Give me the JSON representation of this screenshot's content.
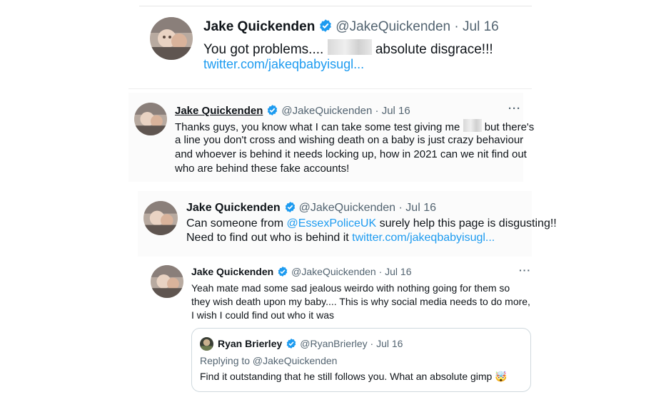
{
  "tweet1": {
    "name": "Jake Quickenden",
    "handle": "@JakeQuickenden",
    "date": "· Jul 16",
    "text_before": "You got problems....",
    "text_after": "absolute disgrace!!!",
    "link": "twitter.com/jakeqbabyisugl..."
  },
  "tweet2": {
    "name": "Jake Quickenden",
    "handle": "@JakeQuickenden",
    "date": "· Jul 16",
    "more": "···",
    "line1_a": "Thanks guys, you know what I can take some test giving me",
    "line1_b": "but there's",
    "line2": "a line you don't cross and wishing death on a baby is just crazy behaviour",
    "line3": "and whoever is behind it needs locking up, how in 2021 can we nit find out",
    "line4": "who are behind these fake accounts!"
  },
  "tweet3": {
    "name": "Jake Quickenden",
    "handle": "@JakeQuickenden",
    "date": "· Jul 16",
    "line1_a": "Can someone from",
    "mention": "@EssexPoliceUK",
    "line1_b": "surely help this page is disgusting!!",
    "line2_a": "Need to find out who is behind it",
    "link": "twitter.com/jakeqbabyisugl..."
  },
  "tweet4": {
    "name": "Jake Quickenden",
    "handle": "@JakeQuickenden",
    "date": "· Jul 16",
    "more": "···",
    "line1": "Yeah mate mad some sad jealous weirdo with nothing going for them so",
    "line2": "they wish death upon my baby.... This is why social media needs to do more,",
    "line3": "I wish I could find out who it was",
    "quote": {
      "name": "Ryan Brierley",
      "handle": "@RyanBrierley",
      "date": "· Jul 16",
      "replying": "Replying to @JakeQuickenden",
      "text": "Find it outstanding that he still follows you. What an absolute gimp",
      "emoji": "🤯"
    }
  },
  "colors": {
    "link": "#1d9bf0",
    "verified": "#1d9bf0",
    "meta": "#536471",
    "text": "#0f1419"
  },
  "icons": [
    "verified-badge-icon",
    "more-options-icon",
    "avatar"
  ]
}
